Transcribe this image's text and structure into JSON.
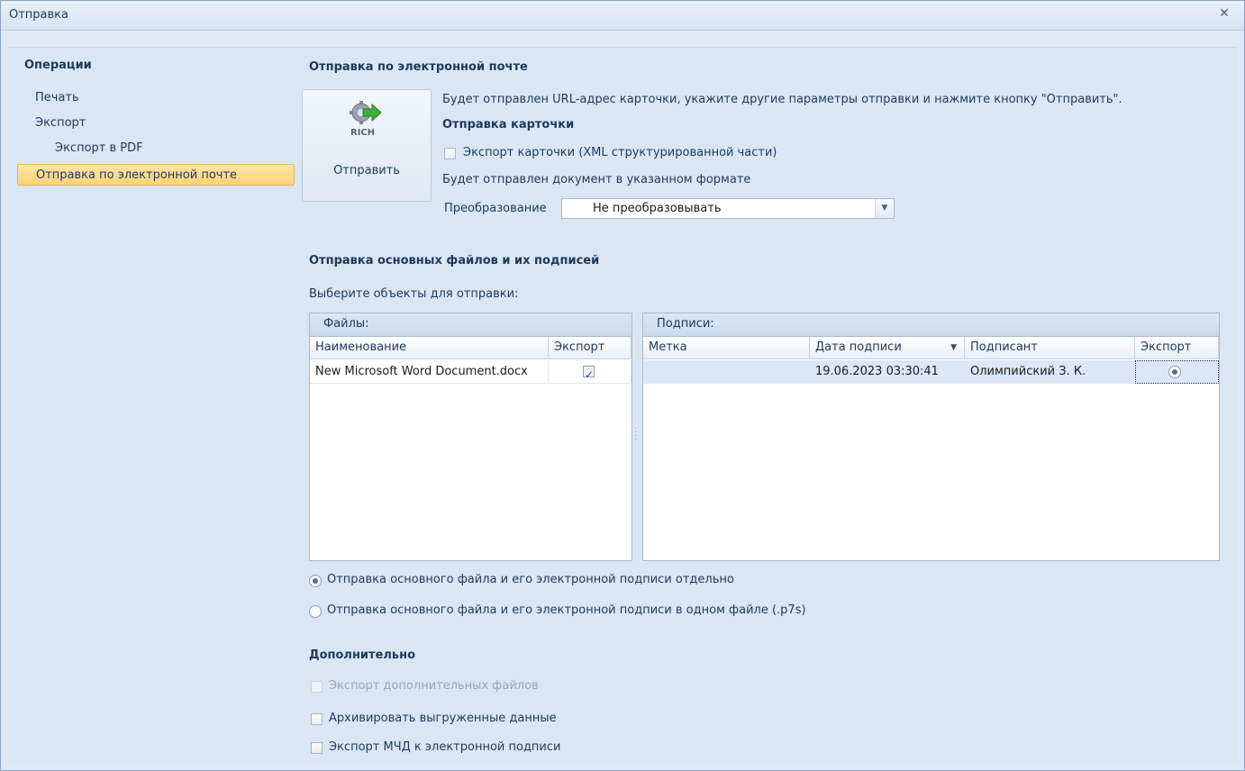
{
  "window": {
    "title": "Отправка",
    "close_icon": "close-icon"
  },
  "sidebar": {
    "header": "Операции",
    "items": [
      {
        "label": "Печать",
        "selected": false
      },
      {
        "label": "Экспорт",
        "selected": false
      },
      {
        "label": "Экспорт в PDF",
        "selected": false
      },
      {
        "label": "Отправка по электронной почте",
        "selected": true
      }
    ]
  },
  "email": {
    "title": "Отправка по электронной почте",
    "description": "Будет отправлен URL-адрес карточки, укажите другие параметры отправки и нажмите кнопку \"Отправить\".",
    "send_button": {
      "label": "Отправить",
      "icon": "rich-send-icon"
    },
    "card_section_title": "Отправка карточки",
    "export_card_label": "Экспорт карточки (XML структурированной части)",
    "export_card_checked": false,
    "format_note": "Будет отправлен документ в указанном формате",
    "conversion_label": "Преобразование",
    "conversion_value": "Не преобразовывать"
  },
  "files_section": {
    "title": "Отправка основных файлов и их подписей",
    "prompt": "Выберите объекты для отправки:",
    "files_panel": {
      "header": "Файлы:",
      "columns": [
        "Наименование",
        "Экспорт"
      ],
      "rows": [
        {
          "name": "New Microsoft Word Document.docx",
          "export": true
        }
      ]
    },
    "signatures_panel": {
      "header": "Подписи:",
      "columns": [
        "Метка",
        "Дата подписи",
        "Подписант",
        "Экспорт"
      ],
      "rows": [
        {
          "mark": "",
          "date": "19.06.2023 03:30:41",
          "signer": "Олимпийский З. К.",
          "export": true
        }
      ]
    },
    "options": [
      {
        "label": "Отправка основного файла и его электронной подписи отдельно",
        "selected": true
      },
      {
        "label": "Отправка основного файла и его электронной подписи в одном файле (.p7s)",
        "selected": false
      }
    ]
  },
  "additional": {
    "title": "Дополнительно",
    "items": [
      {
        "label": "Экспорт дополнительных  файлов",
        "checked": false,
        "disabled": true
      },
      {
        "label": "Архивировать выгруженные данные",
        "checked": false,
        "disabled": false
      },
      {
        "label": "Экспорт МЧД к электронной подписи",
        "checked": false,
        "disabled": false
      }
    ]
  },
  "colors": {
    "accent_selected": "#fbd277",
    "panel_header": "#c9d9ee",
    "background": "#dbe6f4"
  }
}
